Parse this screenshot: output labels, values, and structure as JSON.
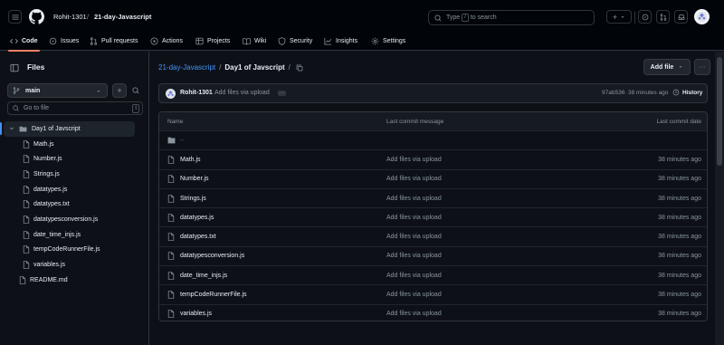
{
  "header": {
    "owner": "Rohit-1301",
    "separator": "/",
    "repo": "21-day-Javascript",
    "search_placeholder_before": "Type",
    "search_key": "/",
    "search_placeholder_after": "to search",
    "plus_label": "+"
  },
  "repo_nav": [
    {
      "label": "Code",
      "icon": "code-icon"
    },
    {
      "label": "Issues",
      "icon": "issue-icon"
    },
    {
      "label": "Pull requests",
      "icon": "pull-request-icon"
    },
    {
      "label": "Actions",
      "icon": "play-icon"
    },
    {
      "label": "Projects",
      "icon": "table-icon"
    },
    {
      "label": "Wiki",
      "icon": "book-icon"
    },
    {
      "label": "Security",
      "icon": "shield-icon"
    },
    {
      "label": "Insights",
      "icon": "graph-icon"
    },
    {
      "label": "Settings",
      "icon": "gear-icon"
    }
  ],
  "sidebar": {
    "title": "Files",
    "branch": "main",
    "go_to_file_placeholder": "Go to file",
    "go_to_file_key": "t",
    "folder": "Day1 of Javscript",
    "files": [
      "Math.js",
      "Number.js",
      "Strings.js",
      "datatypes.js",
      "datatypes.txt",
      "datatypesconversion.js",
      "date_time_injs.js",
      "tempCodeRunnerFile.js",
      "variables.js"
    ],
    "root_file": "README.md"
  },
  "breadcrumb": {
    "repo": "21-day-Javascript",
    "sep1": "/",
    "folder": "Day1 of Javscript",
    "sep2": "/"
  },
  "actions": {
    "add_file": "Add file",
    "more": "···"
  },
  "commit": {
    "author": "Rohit-1301",
    "message": "Add files via upload",
    "hash": "97ab536",
    "time": " · 38 minutes ago",
    "history": "History"
  },
  "table": {
    "col_name": "Name",
    "col_message": "Last commit message",
    "col_date": "Last commit date",
    "parent": "..",
    "rows": [
      {
        "name": "Math.js",
        "message": "Add files via upload",
        "date": "38 minutes ago"
      },
      {
        "name": "Number.js",
        "message": "Add files via upload",
        "date": "38 minutes ago"
      },
      {
        "name": "Strings.js",
        "message": "Add files via upload",
        "date": "38 minutes ago"
      },
      {
        "name": "datatypes.js",
        "message": "Add files via upload",
        "date": "38 minutes ago"
      },
      {
        "name": "datatypes.txt",
        "message": "Add files via upload",
        "date": "38 minutes ago"
      },
      {
        "name": "datatypesconversion.js",
        "message": "Add files via upload",
        "date": "38 minutes ago"
      },
      {
        "name": "date_time_injs.js",
        "message": "Add files via upload",
        "date": "38 minutes ago"
      },
      {
        "name": "tempCodeRunnerFile.js",
        "message": "Add files via upload",
        "date": "38 minutes ago"
      },
      {
        "name": "variables.js",
        "message": "Add files via upload",
        "date": "38 minutes ago"
      }
    ]
  },
  "colors": {
    "background": "#0d1117",
    "header": "#010409",
    "accent": "#f78166",
    "link": "#4493f8",
    "border": "#30363d",
    "muted": "#8b949e"
  }
}
